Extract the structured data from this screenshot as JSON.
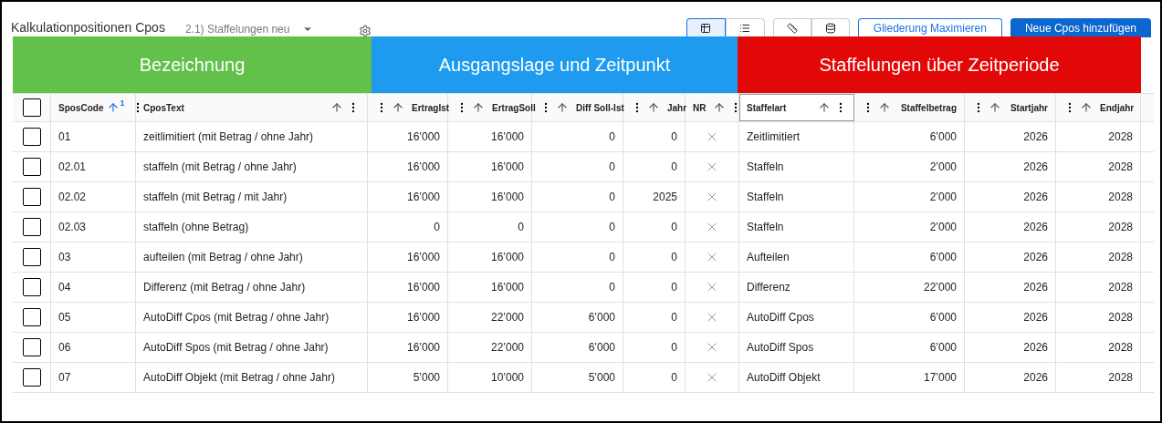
{
  "title": "Kalkulationpositionen Cpos",
  "view_selector": {
    "value": "2.1) Staffelungen neu"
  },
  "view_toggles": [
    {
      "kind": "table",
      "selected": true
    },
    {
      "kind": "list",
      "selected": false
    }
  ],
  "tool_buttons": [
    {
      "kind": "ruler"
    },
    {
      "kind": "database"
    }
  ],
  "actions": [
    {
      "label": "Gliederung Maximieren",
      "kind": "outline"
    },
    {
      "label": "Neue Cpos hinzufügen",
      "kind": "primary"
    }
  ],
  "banners": [
    {
      "label": "Bezeichnung",
      "color": "#61c14a"
    },
    {
      "label": "Ausgangslage und Zeitpunkt",
      "color": "#1e9bef"
    },
    {
      "label": "Staffelungen über Zeitperiode",
      "color": "#e30808"
    }
  ],
  "select_all": {
    "checked": false
  },
  "columns": [
    {
      "label": "SposCode",
      "kind": "text",
      "sorted": true,
      "sort_rank": "1",
      "focused": false
    },
    {
      "label": "CposText",
      "kind": "text",
      "sorted": false,
      "focused": false
    },
    {
      "label": "ErtragIst",
      "kind": "number",
      "sorted": false,
      "focused": false
    },
    {
      "label": "ErtragSoll",
      "kind": "number",
      "sorted": false,
      "focused": false
    },
    {
      "label": "Diff Soll-Ist",
      "kind": "number",
      "sorted": false,
      "focused": false
    },
    {
      "label": "Jahr",
      "kind": "number",
      "sorted": false,
      "focused": false
    },
    {
      "label": "NR",
      "kind": "text",
      "sorted": false,
      "focused": false
    },
    {
      "label": "Staffelart",
      "kind": "text",
      "sorted": false,
      "focused": true
    },
    {
      "label": "Staffelbetrag",
      "kind": "number",
      "sorted": false,
      "focused": false
    },
    {
      "label": "Startjahr",
      "kind": "number",
      "sorted": false,
      "focused": false
    },
    {
      "label": "Endjahr",
      "kind": "number",
      "sorted": false,
      "focused": false
    }
  ],
  "rows": [
    {
      "checked": false,
      "cells": [
        "01",
        "zeitlimitiert (mit Betrag / ohne Jahr)",
        "16’000",
        "16’000",
        "0",
        "0",
        false,
        "Zeitlimitiert",
        "6’000",
        "2026",
        "2028"
      ]
    },
    {
      "checked": false,
      "cells": [
        "02.01",
        "staffeln (mit Betrag / ohne Jahr)",
        "16’000",
        "16’000",
        "0",
        "0",
        false,
        "Staffeln",
        "2’000",
        "2026",
        "2028"
      ]
    },
    {
      "checked": false,
      "cells": [
        "02.02",
        "staffeln (mit Betrag / mit Jahr)",
        "16’000",
        "16’000",
        "0",
        "2025",
        false,
        "Staffeln",
        "2’000",
        "2026",
        "2028"
      ]
    },
    {
      "checked": false,
      "cells": [
        "02.03",
        "staffeln (ohne Betrag)",
        "0",
        "0",
        "0",
        "0",
        false,
        "Staffeln",
        "2’000",
        "2026",
        "2028"
      ]
    },
    {
      "checked": false,
      "cells": [
        "03",
        "aufteilen (mit Betrag / ohne Jahr)",
        "16’000",
        "16’000",
        "0",
        "0",
        false,
        "Aufteilen",
        "6’000",
        "2026",
        "2028"
      ]
    },
    {
      "checked": false,
      "cells": [
        "04",
        "Differenz (mit Betrag / ohne Jahr)",
        "16’000",
        "16’000",
        "0",
        "0",
        false,
        "Differenz",
        "22’000",
        "2026",
        "2028"
      ]
    },
    {
      "checked": false,
      "cells": [
        "05",
        "AutoDiff Cpos (mit Betrag / ohne Jahr)",
        "16’000",
        "22’000",
        "6’000",
        "0",
        false,
        "AutoDiff Cpos",
        "6’000",
        "2026",
        "2028"
      ]
    },
    {
      "checked": false,
      "cells": [
        "06",
        "AutoDiff Spos (mit Betrag / ohne Jahr)",
        "16’000",
        "22’000",
        "6’000",
        "0",
        false,
        "AutoDiff Spos",
        "6’000",
        "2026",
        "2028"
      ]
    },
    {
      "checked": false,
      "cells": [
        "07",
        "AutoDiff Objekt (mit Betrag / ohne Jahr)",
        "5’000",
        "10’000",
        "5’000",
        "0",
        false,
        "AutoDiff Objekt",
        "17’000",
        "2026",
        "2028"
      ]
    }
  ]
}
